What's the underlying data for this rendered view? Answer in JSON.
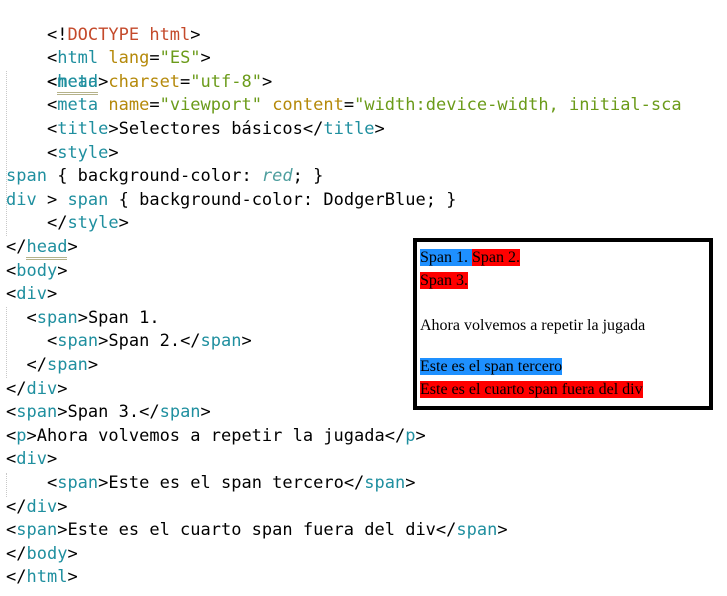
{
  "code": {
    "doctype": [
      "<!",
      "DOCTYPE",
      " html",
      ">"
    ],
    "l2": [
      "<",
      "html",
      " lang",
      "=",
      "\"ES\"",
      ">"
    ],
    "l3": [
      "<",
      "head",
      ">"
    ],
    "l4": [
      "<",
      "meta",
      " charset",
      "=",
      "\"utf-8\"",
      ">"
    ],
    "l5": [
      "<",
      "meta",
      " name",
      "=",
      "\"viewport\"",
      " content",
      "=",
      "\"width:device-width, initial-sca"
    ],
    "l6": [
      "<",
      "title",
      ">",
      "Selectores básicos",
      "</",
      "title",
      ">"
    ],
    "l7": [
      "<",
      "style",
      ">"
    ],
    "l8": [
      "span",
      " { ",
      "background-color",
      ": ",
      "red",
      "; }"
    ],
    "l9": [
      "div",
      " > ",
      "span",
      " { ",
      "background-color",
      ": ",
      "DodgerBlue",
      "; }"
    ],
    "l10": [
      "</",
      "style",
      ">"
    ],
    "l11": [
      "</",
      "head",
      ">"
    ],
    "l12": [
      "<",
      "body",
      ">"
    ],
    "l13": [
      "<",
      "div",
      ">"
    ],
    "l14": [
      "<",
      "span",
      ">",
      "Span 1."
    ],
    "l15": [
      "<",
      "span",
      ">",
      "Span 2.",
      "</",
      "span",
      ">"
    ],
    "l16": [
      "</",
      "span",
      ">"
    ],
    "l17": [
      "</",
      "div",
      ">"
    ],
    "l18": [
      "<",
      "span",
      ">",
      "Span 3.",
      "</",
      "span",
      ">"
    ],
    "l19": [
      "<",
      "p",
      ">",
      "Ahora volvemos a repetir la jugada",
      "</",
      "p",
      ">"
    ],
    "l20": [
      "<",
      "div",
      ">"
    ],
    "l21": [
      "<",
      "span",
      ">",
      "Este es el span tercero",
      "</",
      "span",
      ">"
    ],
    "l22": [
      "</",
      "div",
      ">"
    ],
    "l23": [
      "<",
      "span",
      ">",
      "Este es el cuarto span fuera del div",
      "</",
      "span",
      ">"
    ],
    "l24": [
      "</",
      "body",
      ">"
    ],
    "l25": [
      "</",
      "html",
      ">"
    ]
  },
  "preview": {
    "span1": "Span 1.",
    "span2": "Span 2.",
    "span3": "Span 3.",
    "paragraph": "Ahora volvemos a repetir la jugada",
    "span_tercero": "Este es el span tercero",
    "span_cuarto": "Este es el cuarto span fuera del div"
  },
  "colors": {
    "tag": "#1f8f9f",
    "attribute": "#b5890a",
    "string": "#6b9b1a",
    "doctype": "#c44a2b",
    "span_red": "#ff0000",
    "span_dodgerblue": "#1e90ff"
  }
}
